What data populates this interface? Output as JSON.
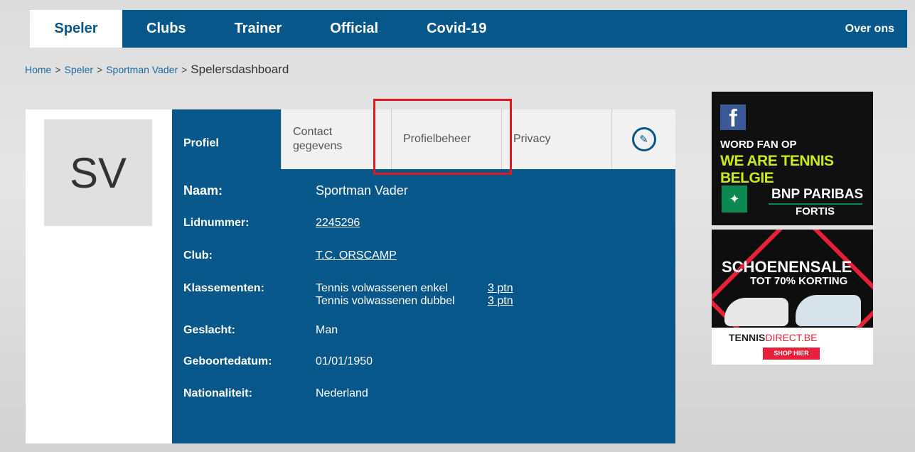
{
  "nav": {
    "items": [
      {
        "label": "Speler",
        "active": true
      },
      {
        "label": "Clubs"
      },
      {
        "label": "Trainer"
      },
      {
        "label": "Official"
      },
      {
        "label": "Covid-19"
      }
    ],
    "right": "Over ons"
  },
  "breadcrumb": {
    "items": [
      "Home",
      "Speler",
      "Sportman Vader"
    ],
    "separator": ">",
    "current": "Spelersdashboard"
  },
  "avatar": {
    "initials": "SV"
  },
  "tabs": {
    "profiel": "Profiel",
    "contact_line1": "Contact",
    "contact_line2": "gegevens",
    "beheer": "Profielbeheer",
    "privacy": "Privacy",
    "edit_icon": "pencil-icon"
  },
  "profile": {
    "naam_label": "Naam:",
    "naam": "Sportman Vader",
    "lid_label": "Lidnummer:",
    "lid": "2245296",
    "club_label": "Club:",
    "club": "T.C. ORSCAMP",
    "klas_label": "Klassementen:",
    "klassementen": [
      {
        "name": "Tennis volwassenen enkel",
        "value": "3 ptn"
      },
      {
        "name": "Tennis volwassenen dubbel",
        "value": "3 ptn"
      }
    ],
    "geslacht_label": "Geslacht:",
    "geslacht": "Man",
    "geboorte_label": "Geboortedatum:",
    "geboorte": "01/01/1950",
    "nat_label": "Nationaliteit:",
    "nat": "Nederland"
  },
  "ads": {
    "ad1_fb": "f",
    "ad1_line1": "WORD FAN OP",
    "ad1_line2": "WE ARE TENNIS BELGIE",
    "ad1_bnp1": "BNP PARIBAS",
    "ad1_bnp2": "FORTIS",
    "ad2_line1": "SCHOENENSALE",
    "ad2_line2": "TOT 70% KORTING",
    "ad2_brand_a": "TENNIS",
    "ad2_brand_b": "DIRECT.BE",
    "ad2_shop": "SHOP HIER"
  },
  "colors": {
    "primary": "#07578a",
    "highlight": "#e0191f"
  }
}
